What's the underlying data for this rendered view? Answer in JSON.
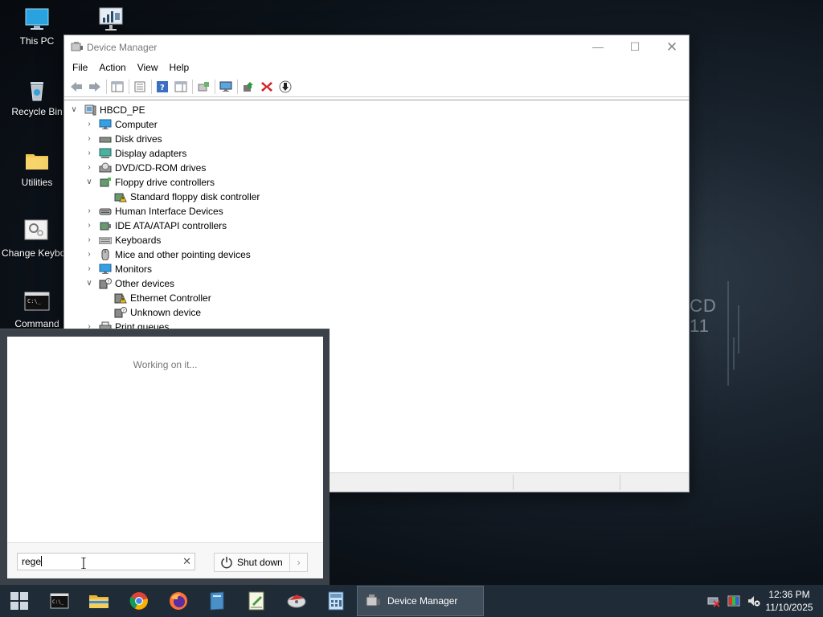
{
  "desktop": {
    "icons": [
      {
        "label": "This PC"
      },
      {
        "label": ""
      },
      {
        "label": "Recycle Bin"
      },
      {
        "label": "Utilities"
      },
      {
        "label": "Change Keyboard Layo"
      },
      {
        "label": "Command"
      }
    ],
    "wallpaper_text": [
      "CD",
      "11"
    ]
  },
  "device_manager": {
    "title": "Device Manager",
    "menu": [
      "File",
      "Action",
      "View",
      "Help"
    ],
    "tree": {
      "root": "HBCD_PE",
      "nodes": [
        {
          "label": "Computer",
          "icon": "computer-icon",
          "expanded": false
        },
        {
          "label": "Disk drives",
          "icon": "disk-drive-icon",
          "expanded": false
        },
        {
          "label": "Display adapters",
          "icon": "display-adapter-icon",
          "expanded": false
        },
        {
          "label": "DVD/CD-ROM drives",
          "icon": "dvd-drive-icon",
          "expanded": false
        },
        {
          "label": "Floppy drive controllers",
          "icon": "floppy-controller-icon",
          "expanded": true,
          "children": [
            {
              "label": "Standard floppy disk controller",
              "icon": "warning-device-icon"
            }
          ]
        },
        {
          "label": "Human Interface Devices",
          "icon": "hid-icon",
          "expanded": false
        },
        {
          "label": "IDE ATA/ATAPI controllers",
          "icon": "ide-controller-icon",
          "expanded": false
        },
        {
          "label": "Keyboards",
          "icon": "keyboard-icon",
          "expanded": false
        },
        {
          "label": "Mice and other pointing devices",
          "icon": "mouse-icon",
          "expanded": false
        },
        {
          "label": "Monitors",
          "icon": "monitor-icon",
          "expanded": false
        },
        {
          "label": "Other devices",
          "icon": "other-devices-icon",
          "expanded": true,
          "children": [
            {
              "label": "Ethernet Controller",
              "icon": "warning-device-icon"
            },
            {
              "label": "Unknown device",
              "icon": "unknown-device-icon"
            }
          ]
        },
        {
          "label": "Print queues",
          "icon": "printer-icon",
          "expanded": false
        }
      ]
    }
  },
  "start_menu": {
    "status_text": "Working on it...",
    "search_value": "rege",
    "shutdown_label": "Shut down"
  },
  "taskbar": {
    "active_task": "Device Manager",
    "time": "12:36 PM",
    "date": "11/10/2025"
  },
  "colors": {
    "taskbar": "#1f2b36",
    "start_panel": "#3a4148",
    "active_task": "#3f4d5a"
  }
}
